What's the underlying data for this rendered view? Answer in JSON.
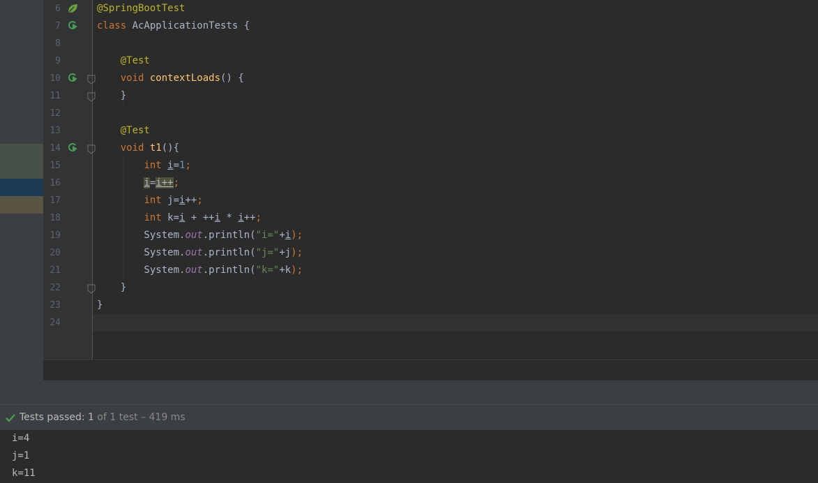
{
  "editor": {
    "lines": [
      {
        "n": "6",
        "icon": "spring-bean-icon",
        "parts": [
          {
            "t": "@SpringBootTest",
            "c": "ann"
          }
        ]
      },
      {
        "n": "7",
        "icon": "run-test-icon",
        "parts": [
          {
            "t": "class ",
            "c": "kw"
          },
          {
            "t": "AcApplicationTests {",
            "c": ""
          }
        ]
      },
      {
        "n": "8",
        "parts": []
      },
      {
        "n": "9",
        "parts": [
          {
            "t": "    ",
            "c": ""
          },
          {
            "t": "@Test",
            "c": "ann"
          }
        ]
      },
      {
        "n": "10",
        "icon": "run-test-icon",
        "fold": true,
        "parts": [
          {
            "t": "    ",
            "c": ""
          },
          {
            "t": "void ",
            "c": "kw"
          },
          {
            "t": "contextLoads",
            "c": "fn"
          },
          {
            "t": "() {",
            "c": ""
          }
        ]
      },
      {
        "n": "11",
        "fold": true,
        "parts": [
          {
            "t": "    }",
            "c": ""
          }
        ]
      },
      {
        "n": "12",
        "parts": []
      },
      {
        "n": "13",
        "parts": [
          {
            "t": "    ",
            "c": ""
          },
          {
            "t": "@Test",
            "c": "ann"
          }
        ]
      },
      {
        "n": "14",
        "icon": "run-test-icon",
        "fold": true,
        "parts": [
          {
            "t": "    ",
            "c": ""
          },
          {
            "t": "void ",
            "c": "kw"
          },
          {
            "t": "t1",
            "c": "fn"
          },
          {
            "t": "(){",
            "c": ""
          }
        ]
      },
      {
        "n": "15",
        "parts": [
          {
            "t": "        ",
            "c": ""
          },
          {
            "t": "int ",
            "c": "kw"
          },
          {
            "t": "i",
            "c": "u"
          },
          {
            "t": "=",
            "c": ""
          },
          {
            "t": "1",
            "c": "num"
          },
          {
            "t": ";",
            "c": "kw"
          }
        ]
      },
      {
        "n": "16",
        "parts": [
          {
            "t": "        ",
            "c": ""
          },
          {
            "t": "i",
            "c": "u hl"
          },
          {
            "t": "=",
            "c": ""
          },
          {
            "t": "i++",
            "c": "u hl"
          },
          {
            "t": ";",
            "c": "kw"
          }
        ]
      },
      {
        "n": "17",
        "parts": [
          {
            "t": "        ",
            "c": ""
          },
          {
            "t": "int ",
            "c": "kw"
          },
          {
            "t": "j=",
            "c": ""
          },
          {
            "t": "i",
            "c": "u"
          },
          {
            "t": "++",
            "c": ""
          },
          {
            "t": ";",
            "c": "kw"
          }
        ]
      },
      {
        "n": "18",
        "parts": [
          {
            "t": "        ",
            "c": ""
          },
          {
            "t": "int ",
            "c": "kw"
          },
          {
            "t": "k=",
            "c": ""
          },
          {
            "t": "i",
            "c": "u"
          },
          {
            "t": " + ++",
            "c": ""
          },
          {
            "t": "i",
            "c": "u"
          },
          {
            "t": " * ",
            "c": ""
          },
          {
            "t": "i",
            "c": "u"
          },
          {
            "t": "++",
            "c": ""
          },
          {
            "t": ";",
            "c": "kw"
          }
        ]
      },
      {
        "n": "19",
        "parts": [
          {
            "t": "        System.",
            "c": ""
          },
          {
            "t": "out",
            "c": "fld"
          },
          {
            "t": ".println(",
            "c": ""
          },
          {
            "t": "\"i=\"",
            "c": "str"
          },
          {
            "t": "+",
            "c": ""
          },
          {
            "t": "i",
            "c": "u"
          },
          {
            "t": ");",
            "c": "kw"
          }
        ]
      },
      {
        "n": "20",
        "parts": [
          {
            "t": "        System.",
            "c": ""
          },
          {
            "t": "out",
            "c": "fld"
          },
          {
            "t": ".println(",
            "c": ""
          },
          {
            "t": "\"j=\"",
            "c": "str"
          },
          {
            "t": "+j",
            "c": ""
          },
          {
            "t": ");",
            "c": "kw"
          }
        ]
      },
      {
        "n": "21",
        "parts": [
          {
            "t": "        System.",
            "c": ""
          },
          {
            "t": "out",
            "c": "fld"
          },
          {
            "t": ".println(",
            "c": ""
          },
          {
            "t": "\"k=\"",
            "c": "str"
          },
          {
            "t": "+k",
            "c": ""
          },
          {
            "t": ");",
            "c": "kw"
          }
        ]
      },
      {
        "n": "22",
        "fold": true,
        "parts": [
          {
            "t": "    }",
            "c": ""
          }
        ]
      },
      {
        "n": "23",
        "parts": [
          {
            "t": "}",
            "c": ""
          }
        ]
      },
      {
        "n": "24",
        "parts": []
      }
    ]
  },
  "status": {
    "label": "Tests passed: ",
    "passed": "1",
    "detail": " of 1 test – 419 ms"
  },
  "console": {
    "lines": [
      "i=4",
      "j=1",
      "k=11"
    ]
  },
  "colors": {
    "keyword": "#cc7832",
    "annotation": "#bbb529",
    "method": "#ffc66d",
    "number": "#6897bb",
    "string": "#6a8759",
    "field": "#9876aa",
    "pass": "#499c54"
  }
}
